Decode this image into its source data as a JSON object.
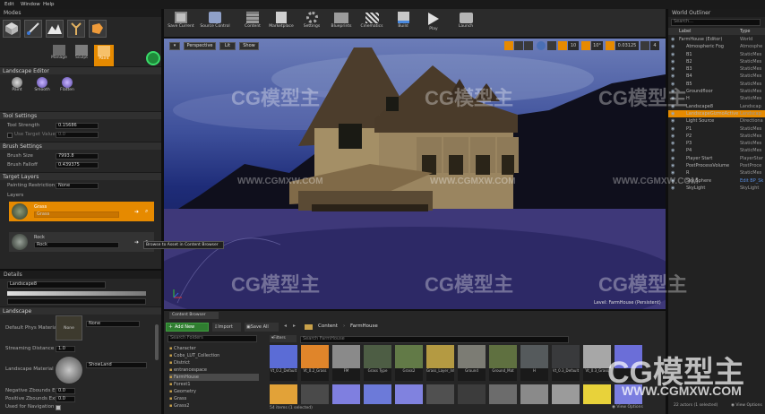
{
  "menu": [
    "Edit",
    "Window",
    "Help"
  ],
  "modes": {
    "title": "Modes",
    "tools": [
      "Manage",
      "Sculpt",
      "Paint"
    ]
  },
  "landscape_editor": {
    "title": "Landscape Editor",
    "brushes": [
      "Paint",
      "Smooth",
      "Flatten"
    ]
  },
  "tool_settings": {
    "title": "Tool Settings",
    "tool_strength_label": "Tool Strength",
    "tool_strength": "0.15686",
    "target_value_label": "Use Target Value",
    "target_value": "0.0"
  },
  "brush_settings": {
    "title": "Brush Settings",
    "size_label": "Brush Size",
    "size": "7993.8",
    "falloff_label": "Brush Falloff",
    "falloff": "0.439375"
  },
  "target_layers": {
    "title": "Target Layers",
    "painting_restriction_label": "Painting Restriction",
    "painting_restriction": "None",
    "layers_label": "Layers",
    "layers": [
      {
        "name": "Grass",
        "sub": "Grass"
      },
      {
        "name": "Rock",
        "sub": "Rock"
      }
    ],
    "tooltip": "Browse to Asset in Content Browser"
  },
  "details": {
    "title": "Details",
    "search_value": "Landscape8",
    "section": "Landscape",
    "props": [
      {
        "label": "Default Phys Material",
        "value": "None"
      },
      {
        "label": "Streaming Distance Mu",
        "value": "1.0"
      },
      {
        "label": "Landscape Material",
        "value": "ShowLand"
      },
      {
        "label": "Negative Zbounds Exte",
        "value": "0.0"
      },
      {
        "label": "Positive Zbounds Exte",
        "value": "0.0"
      },
      {
        "label": "Used for Navigation",
        "value": ""
      }
    ],
    "thumb_label": "None"
  },
  "toolbar": {
    "buttons": [
      "Save Current",
      "Source Control",
      "Content",
      "Marketplace",
      "Settings",
      "Blueprints",
      "Cinematics",
      "Build",
      "Play",
      "Launch"
    ]
  },
  "viewport": {
    "perspective": "Perspective",
    "lit": "Lit",
    "show": "Show",
    "snap_value": "10",
    "rot_value": "10°",
    "scale_value": "0.03125",
    "cam_value": "4",
    "level_label": "Level: FarmHouse (Persistent)"
  },
  "world_outliner": {
    "title": "World Outliner",
    "search_placeholder": "Search...",
    "col_label": "Label",
    "col_type": "Type",
    "rows": [
      {
        "label": "FarmHouse (Editor)",
        "type": "World"
      },
      {
        "label": "Atmospheric Fog",
        "type": "Atmosphe"
      },
      {
        "label": "B1",
        "type": "StaticMes"
      },
      {
        "label": "B2",
        "type": "StaticMes"
      },
      {
        "label": "B3",
        "type": "StaticMes"
      },
      {
        "label": "B4",
        "type": "StaticMes"
      },
      {
        "label": "B5",
        "type": "StaticMes"
      },
      {
        "label": "Groundfloor",
        "type": "StaticMes"
      },
      {
        "label": "H",
        "type": "StaticMes"
      },
      {
        "label": "Landscape8",
        "type": "Landscap"
      },
      {
        "label": "LandscapeGizmoActive",
        "type": "Landscap"
      },
      {
        "label": "Light Source",
        "type": "Directiona"
      },
      {
        "label": "P1",
        "type": "StaticMes"
      },
      {
        "label": "P2",
        "type": "StaticMes"
      },
      {
        "label": "P3",
        "type": "StaticMes"
      },
      {
        "label": "P4",
        "type": "StaticMes"
      },
      {
        "label": "Player Start",
        "type": "PlayerStar"
      },
      {
        "label": "PostProcessVolume",
        "type": "PostProce"
      },
      {
        "label": "R",
        "type": "StaticMes"
      },
      {
        "label": "Sky Sphere",
        "type": "Edit BP_Sk"
      },
      {
        "label": "SkyLight",
        "type": "SkyLight"
      }
    ],
    "footer": "22 actors (1 selected)",
    "view_options": "View Options"
  },
  "content_browser": {
    "tab": "Content Browser",
    "add_new": "Add New",
    "import": "Import",
    "save_all": "Save All",
    "path": [
      "Content",
      "FarmHouse"
    ],
    "search_placeholder": "Search Folders",
    "filters": "Filters",
    "search_assets": "Search FarmHouse",
    "folders": [
      "Character",
      "Cobs_LUT_Collection",
      "District",
      "entrancespace",
      "FarmHouse",
      "Forest1",
      "Geometry",
      "Grass",
      "Grass2",
      "Ground"
    ],
    "assets_row1": [
      {
        "label": "Vt_0.2_Default",
        "color": "#5b6cd6"
      },
      {
        "label": "Vt_0.2_Grass",
        "color": "#e0852a"
      },
      {
        "label": "FM",
        "color": "#8a8a8a"
      },
      {
        "label": "Grass Type",
        "color": "#4d5d44"
      },
      {
        "label": "Grass2",
        "color": "#627a47"
      },
      {
        "label": "Grass_Layer_Info",
        "color": "#b49a42"
      },
      {
        "label": "Ground",
        "color": "#7c7c74"
      },
      {
        "label": "Ground_Mat",
        "color": "#5f7040"
      },
      {
        "label": "H",
        "color": "#555a5c"
      },
      {
        "label": "Vt_0.3_Default",
        "color": "#393a3c"
      },
      {
        "label": "Vt_0.3_Grass",
        "color": "#a7a7a7"
      },
      {
        "label": "",
        "color": "#6b6ed8"
      }
    ],
    "assets_row2": [
      {
        "label": "",
        "color": "#e2a238"
      },
      {
        "label": "",
        "color": "#4a4a4a"
      },
      {
        "label": "",
        "color": "#7f7fe0"
      },
      {
        "label": "",
        "color": "#6c7ad9"
      },
      {
        "label": "",
        "color": "#8082df"
      },
      {
        "label": "",
        "color": "#505050"
      },
      {
        "label": "",
        "color": "#3c3c3c"
      },
      {
        "label": "",
        "color": "#6c6c6c"
      },
      {
        "label": "",
        "color": "#8a8a8a"
      },
      {
        "label": "",
        "color": "#9b9b9b"
      },
      {
        "label": "",
        "color": "#e8d23a"
      },
      {
        "label": "",
        "color": "#7b7ee0"
      }
    ],
    "footer": "54 items (1 selected)",
    "view_options": "View Options"
  },
  "watermarks": {
    "logo": "CG模型主",
    "url": "WWW.CGMXW.COM"
  },
  "colors": {
    "accent": "#e68a00",
    "sky_top": "#2e3f86",
    "ground": "#3b3574"
  }
}
